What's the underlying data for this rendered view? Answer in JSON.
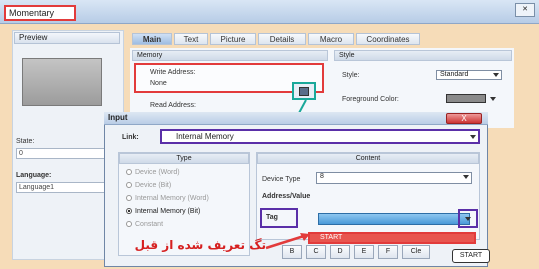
{
  "window": {
    "title": "Momentary"
  },
  "left_panel": {
    "preview_label": "Preview",
    "state_label": "State:",
    "state_value": "0",
    "language_label": "Language:",
    "language_value": "Language1"
  },
  "tabs": [
    "Main",
    "Text",
    "Picture",
    "Details",
    "Macro",
    "Coordinates"
  ],
  "memory_section": {
    "title": "Memory",
    "write_address_label": "Write Address:",
    "write_address_value": "None",
    "read_address_label": "Read Address:"
  },
  "style_section": {
    "title": "Style",
    "style_label": "Style:",
    "style_value": "Standard",
    "foreground_label": "Foreground Color:"
  },
  "input_dialog": {
    "title": "Input",
    "close_label": "X",
    "link_label": "Link:",
    "link_value": "Internal Memory",
    "type_header": "Type",
    "content_header": "Content",
    "types": [
      {
        "label": "Device (Word)",
        "selected": false
      },
      {
        "label": "Device (Bit)",
        "selected": false
      },
      {
        "label": "Internal Memory (Word)",
        "selected": false
      },
      {
        "label": "Internal Memory (Bit)",
        "selected": true
      },
      {
        "label": "Constant",
        "selected": false
      }
    ],
    "device_type_label": "Device Type",
    "device_type_value": "8",
    "address_value_label": "Address/Value",
    "tag_label": "Tag",
    "tag_option": "START",
    "keys": [
      "B",
      "C",
      "D",
      "E",
      "F",
      "Cle"
    ]
  },
  "annotation": {
    "text": "تگ تعریف شده از قبل",
    "color": "#d62020"
  },
  "tooltip": "START",
  "colors": {
    "highlight_red": "#e23b3b",
    "highlight_purple": "#5a2fa8",
    "highlight_teal": "#1aa89a"
  }
}
